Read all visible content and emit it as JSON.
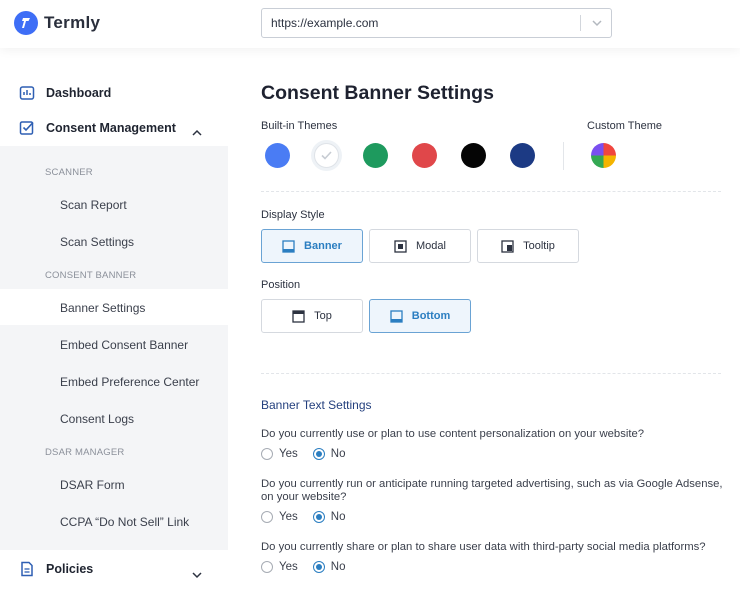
{
  "app": {
    "name": "Termly"
  },
  "urlbar": {
    "value": "https://example.com"
  },
  "sidebar": {
    "dashboard": "Dashboard",
    "consent_management": "Consent Management",
    "sections": {
      "scanner": "SCANNER",
      "consent_banner": "CONSENT BANNER",
      "dsar_manager": "DSAR MANAGER"
    },
    "items": {
      "scan_report": "Scan Report",
      "scan_settings": "Scan Settings",
      "banner_settings": "Banner Settings",
      "embed_consent_banner": "Embed Consent Banner",
      "embed_preference_center": "Embed Preference Center",
      "consent_logs": "Consent Logs",
      "dsar_form": "DSAR Form",
      "ccpa_link": "CCPA “Do Not Sell” Link"
    },
    "policies": "Policies",
    "active_item": "Banner Settings"
  },
  "main": {
    "title": "Consent Banner Settings",
    "themes": {
      "builtin_label": "Built-in Themes",
      "custom_label": "Custom Theme",
      "swatches": [
        {
          "name": "blue",
          "color": "#4a7cf4"
        },
        {
          "name": "white",
          "color": "#ffffff",
          "selected": true
        },
        {
          "name": "green",
          "color": "#1e9a5e"
        },
        {
          "name": "red",
          "color": "#e0474a"
        },
        {
          "name": "black",
          "color": "#050505"
        },
        {
          "name": "navy",
          "color": "#1c3a84"
        }
      ]
    },
    "display_style": {
      "label": "Display Style",
      "options": [
        "Banner",
        "Modal",
        "Tooltip"
      ],
      "selected": "Banner"
    },
    "position": {
      "label": "Position",
      "options": [
        "Top",
        "Bottom"
      ],
      "selected": "Bottom"
    },
    "banner_text": {
      "title": "Banner Text Settings",
      "questions": [
        {
          "text": "Do you currently use or plan to use content personalization on your website?",
          "yes": "Yes",
          "no": "No",
          "selected": "No"
        },
        {
          "text": "Do you currently run or anticipate running targeted advertising, such as via Google Adsense, on your website?",
          "yes": "Yes",
          "no": "No",
          "selected": "No"
        },
        {
          "text": "Do you currently share or plan to share user data with third-party social media platforms?",
          "yes": "Yes",
          "no": "No",
          "selected": "No"
        }
      ]
    }
  },
  "colors": {
    "accent": "#2b7ec1",
    "brand": "#3e6ef6",
    "heading_link": "#24407e"
  }
}
